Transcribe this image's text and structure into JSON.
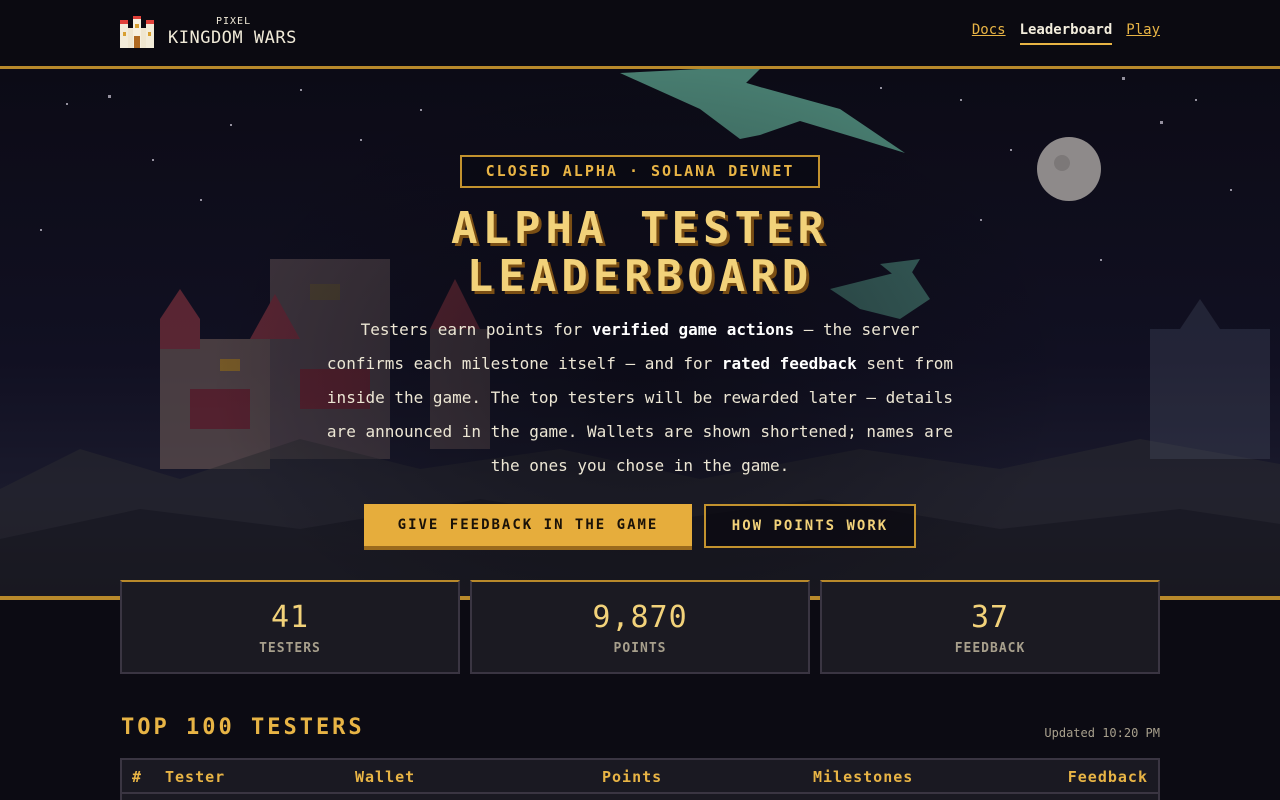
{
  "brand": {
    "small": "PIXEL",
    "main": "KINGDOM WARS"
  },
  "nav": [
    {
      "label": "Docs",
      "active": false
    },
    {
      "label": "Leaderboard",
      "active": true
    },
    {
      "label": "Play",
      "active": false
    }
  ],
  "hero": {
    "badge": "CLOSED ALPHA · SOLANA DEVNET",
    "title_line1": "ALPHA TESTER",
    "title_line2": "LEADERBOARD",
    "desc": {
      "p1": "Testers earn points for ",
      "b1": "verified game actions",
      "p2": " — the server confirms each milestone itself — and for ",
      "b2": "rated feedback",
      "p3": " sent from inside the game. The top testers will be rewarded later — details are announced in the game. Wallets are shown shortened; names are the ones you chose in the game."
    },
    "primary_button": "GIVE FEEDBACK IN THE GAME",
    "secondary_button": "HOW POINTS WORK"
  },
  "stats": [
    {
      "value": "41",
      "label": "TESTERS"
    },
    {
      "value": "9,870",
      "label": "POINTS"
    },
    {
      "value": "37",
      "label": "FEEDBACK"
    }
  ],
  "leaderboard": {
    "title": "TOP 100 TESTERS",
    "updated": "Updated 10:20 PM",
    "columns": [
      "#",
      "Tester",
      "Wallet",
      "Points",
      "Milestones",
      "Feedback"
    ]
  },
  "colors": {
    "gold": "#e8b445",
    "title": "#f2d27a",
    "bg": "#0c0b13",
    "panel": "#1b1a22"
  }
}
